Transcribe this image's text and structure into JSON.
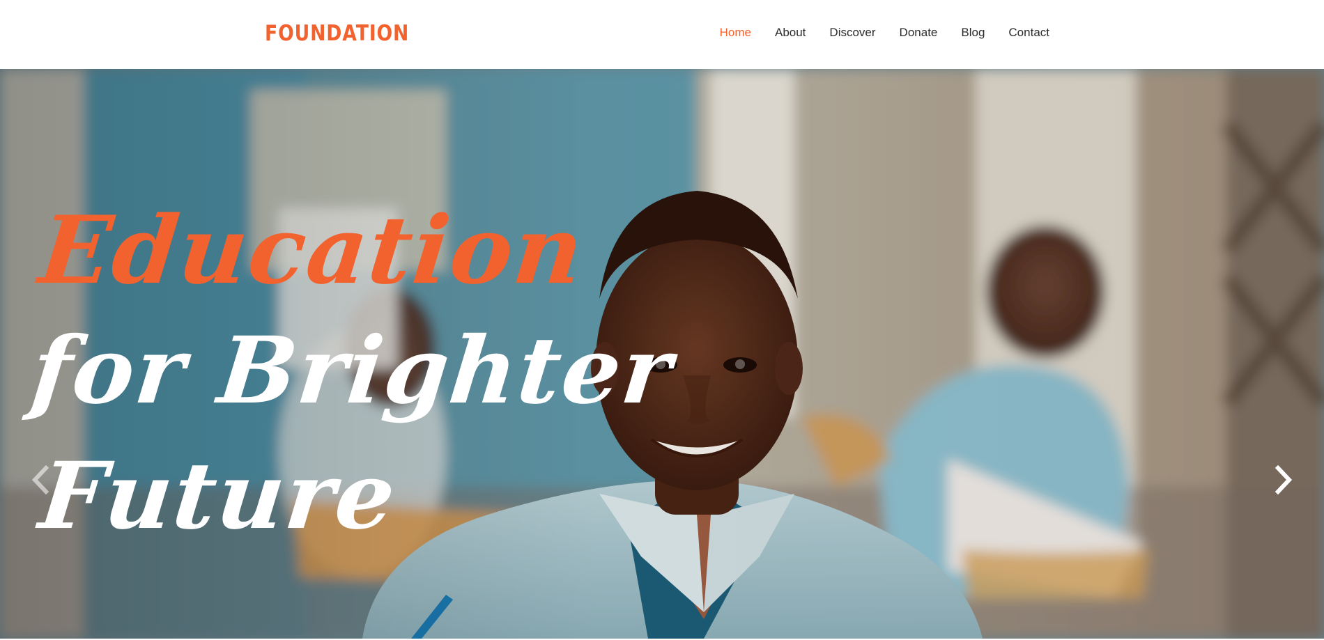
{
  "header": {
    "logo": "FOUNDATION",
    "nav": [
      {
        "label": "Home",
        "active": true
      },
      {
        "label": "About"
      },
      {
        "label": "Discover"
      },
      {
        "label": "Donate"
      },
      {
        "label": "Blog"
      },
      {
        "label": "Contact"
      }
    ]
  },
  "hero": {
    "headline": {
      "line1": "Education",
      "line2": "for Brighter",
      "line3": "Future"
    },
    "controls": {
      "prev_icon": "chevron-left-icon",
      "next_icon": "chevron-right-icon"
    }
  },
  "colors": {
    "accent": "#f2622e",
    "nav_text": "#2b2b2b",
    "white": "#ffffff"
  }
}
